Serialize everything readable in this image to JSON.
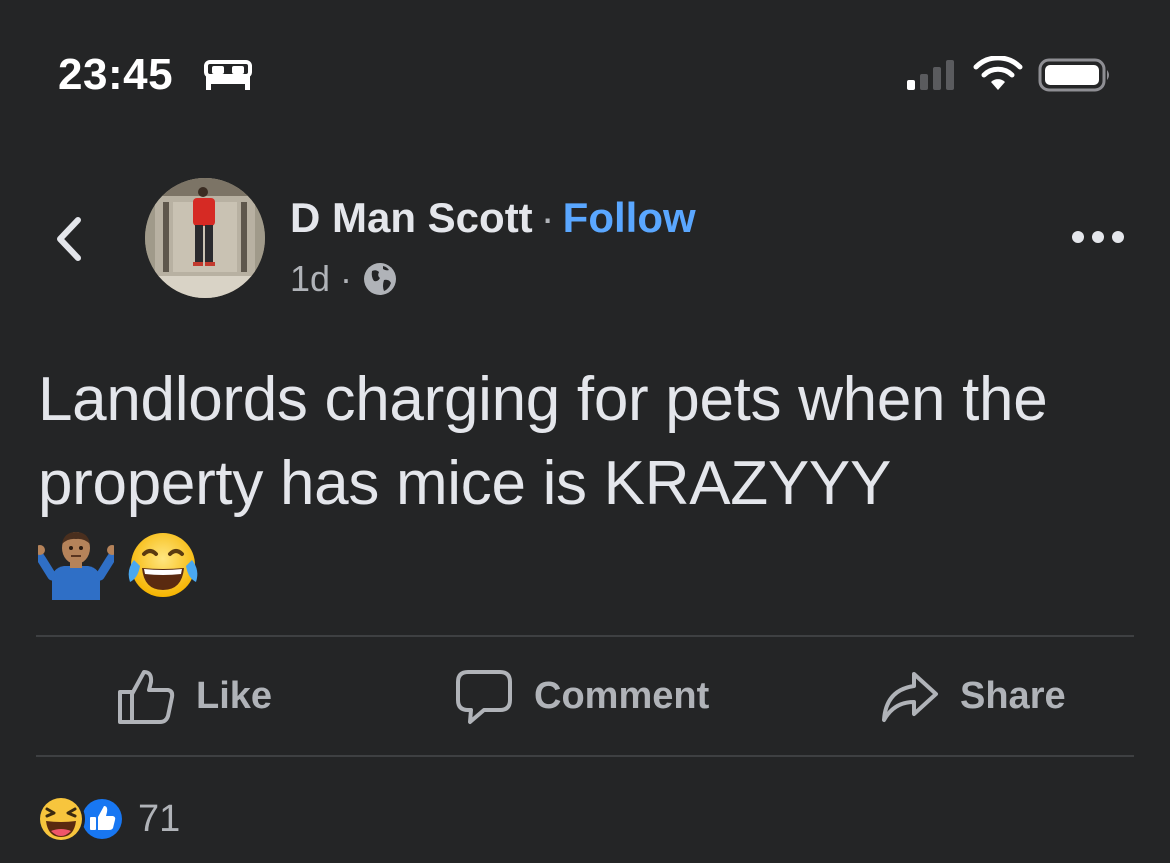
{
  "status_bar": {
    "time": "23:45",
    "icons": [
      "bed-icon",
      "signal-icon",
      "wifi-icon",
      "battery-icon"
    ]
  },
  "post": {
    "author": "D Man Scott",
    "separator": "·",
    "follow_label": "Follow",
    "age": "1d",
    "meta_separator": "·",
    "audience_icon": "globe-icon",
    "text": "Landlords charging for pets when the property has mice is KRAZYYY",
    "emojis": [
      "man-shrugging-emoji",
      "face-with-tears-of-joy-emoji"
    ]
  },
  "actions": {
    "like_label": "Like",
    "comment_label": "Comment",
    "share_label": "Share"
  },
  "reactions": {
    "icons": [
      "haha-reaction-icon",
      "like-reaction-icon"
    ],
    "count": "71"
  },
  "colors": {
    "background": "#242526",
    "text_primary": "#e4e6eb",
    "text_secondary": "#b0b3b8",
    "link": "#5aa7ff",
    "like_blue": "#1877f2",
    "divider": "#3e4042"
  }
}
